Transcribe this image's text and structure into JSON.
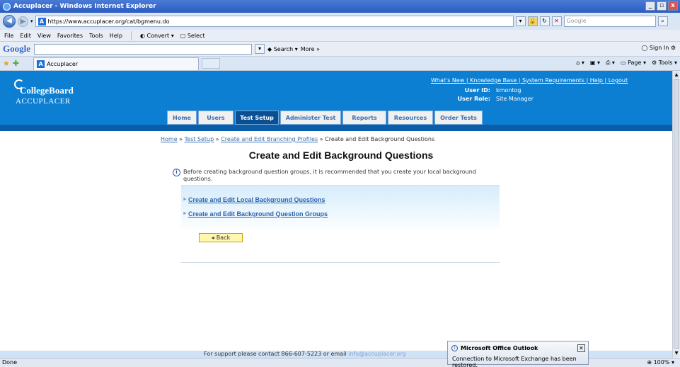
{
  "window": {
    "title": "Accuplacer - Windows Internet Explorer",
    "min": "_",
    "max": "▫",
    "close": "x"
  },
  "address": {
    "url": "https://www.accuplacer.org/cat/bgmenu.do",
    "search_placeholder": "Google"
  },
  "menu": {
    "items": [
      "File",
      "Edit",
      "View",
      "Favorites",
      "Tools",
      "Help"
    ],
    "convert": "Convert",
    "select": "Select"
  },
  "googlebar": {
    "logo": "Google",
    "search": "Search",
    "more": "More »",
    "signin": "Sign In"
  },
  "tabs": {
    "active": "Accuplacer",
    "page": "Page",
    "tools": "Tools"
  },
  "site": {
    "brand": "CollegeBoard",
    "product": "ACCUPLACER",
    "toplinks": "What's New | Knowledge Base | System Requirements | Help | Logout",
    "user_id_label": "User ID:",
    "user_id": "kmontog",
    "user_role_label": "User Role:",
    "user_role": "Site Manager",
    "nav": [
      "Home",
      "Users",
      "Test Setup",
      "Administer Test",
      "Reports",
      "Resources",
      "Order Tests"
    ]
  },
  "breadcrumb": {
    "home": "Home",
    "test_setup": "Test Setup",
    "branching": "Create and Edit Branching Profiles",
    "current": "Create and Edit Background Questions",
    "sep": "»"
  },
  "main": {
    "title": "Create and Edit Background Questions",
    "info": "Before creating background question groups, it is recommended that you create your local background questions.",
    "link1": "Create and Edit Local Background Questions",
    "link2": "Create and Edit Background Question Groups",
    "back": "Back"
  },
  "footer": {
    "text": "For support please contact 866-607-5223 or email ",
    "email": "info@accuplacer.org"
  },
  "status": {
    "left": "Done",
    "zoom": "100%"
  },
  "toast": {
    "title": "Microsoft Office Outlook",
    "message": "Connection to Microsoft Exchange has been restored."
  }
}
